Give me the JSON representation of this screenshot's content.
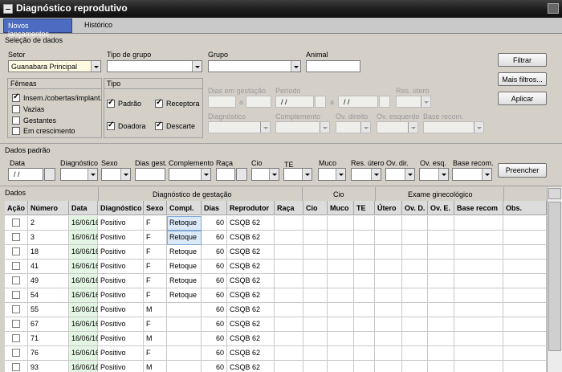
{
  "window": {
    "title": "Diagnóstico reprodutivo"
  },
  "tabs": [
    {
      "label": "Novos lançamentos"
    },
    {
      "label": "Histórico"
    }
  ],
  "selecao": {
    "section_title": "Seleção de dados",
    "setor_label": "Setor",
    "setor_value": "Guanabara Principal",
    "tipo_grupo_label": "Tipo de grupo",
    "grupo_label": "Grupo",
    "animal_label": "Animal",
    "femeas_label": "Fêmeas",
    "femeas_options": [
      {
        "label": "Insem./cobertas/implant.",
        "checked": true
      },
      {
        "label": "Vazias",
        "checked": false
      },
      {
        "label": "Gestantes",
        "checked": false
      },
      {
        "label": "Em crescimento",
        "checked": false
      }
    ],
    "tipo_label": "Tipo",
    "tipo_options": [
      {
        "label": "Padrão",
        "checked": true
      },
      {
        "label": "Receptora",
        "checked": true
      },
      {
        "label": "Doadora",
        "checked": true
      },
      {
        "label": "Descarte",
        "checked": true
      }
    ],
    "dias_gestacao_label": "Dias em gestação",
    "periodo_label": "Período",
    "date_mask": "/ /",
    "a_label": "a",
    "res_utero_label": "Res. útero",
    "diagnostico_label": "Diagnóstico",
    "complemento_label": "Complemento",
    "ov_direito_label": "Ov. direito",
    "ov_esquerdo_label": "Ov. esquerdo",
    "base_recom_label": "Base recom.",
    "btn_filtrar": "Filtrar",
    "btn_mais_filtros": "Mais filtros...",
    "btn_aplicar": "Aplicar"
  },
  "padrao": {
    "section_title": "Dados padrão",
    "labels": {
      "data": "Data",
      "diagnostico": "Diagnóstico",
      "sexo": "Sexo",
      "dias_gest": "Dias gest.",
      "complemento": "Complemento",
      "raca": "Raça",
      "cio": "Cio",
      "te": "TE",
      "muco": "Muco",
      "res_utero": "Res. útero",
      "ov_dir": "Ov. dir.",
      "ov_esq": "Ov. esq.",
      "base_recom": "Base recom."
    },
    "data_value": "/ /",
    "btn_preencher": "Preencher"
  },
  "dados": {
    "section_title": "Dados",
    "group_headers": {
      "diag_gestacao": "Diagnóstico de gestação",
      "cio": "Cio",
      "exame": "Exame ginecológico"
    },
    "columns": [
      "Ação",
      "Número",
      "Data",
      "Diagnóstico",
      "Sexo",
      "Compl.",
      "Dias",
      "Reprodutor",
      "Raça",
      "Cio",
      "Muco",
      "TE",
      "Útero",
      "Ov. D.",
      "Ov. E.",
      "Base recom",
      "Obs."
    ],
    "rows": [
      {
        "numero": "2",
        "data": "16/06/16",
        "diagnostico": "Positivo",
        "sexo": "F",
        "compl": "Retoque",
        "dias": "60",
        "reprodutor": "CSQB 62"
      },
      {
        "numero": "3",
        "data": "16/06/16",
        "diagnostico": "Positivo",
        "sexo": "F",
        "compl": "Retoque",
        "dias": "60",
        "reprodutor": "CSQB 62"
      },
      {
        "numero": "18",
        "data": "16/06/16",
        "diagnostico": "Positivo",
        "sexo": "F",
        "compl": "Retoque",
        "dias": "60",
        "reprodutor": "CSQB 62"
      },
      {
        "numero": "41",
        "data": "16/06/16",
        "diagnostico": "Positivo",
        "sexo": "F",
        "compl": "Retoque",
        "dias": "60",
        "reprodutor": "CSQB 62"
      },
      {
        "numero": "49",
        "data": "16/06/16",
        "diagnostico": "Positivo",
        "sexo": "F",
        "compl": "Retoque",
        "dias": "60",
        "reprodutor": "CSQB 62"
      },
      {
        "numero": "54",
        "data": "16/06/16",
        "diagnostico": "Positivo",
        "sexo": "F",
        "compl": "Retoque",
        "dias": "60",
        "reprodutor": "CSQB 62"
      },
      {
        "numero": "55",
        "data": "16/06/16",
        "diagnostico": "Positivo",
        "sexo": "M",
        "compl": "",
        "dias": "60",
        "reprodutor": "CSQB 62"
      },
      {
        "numero": "67",
        "data": "16/06/16",
        "diagnostico": "Positivo",
        "sexo": "F",
        "compl": "",
        "dias": "60",
        "reprodutor": "CSQB 62"
      },
      {
        "numero": "71",
        "data": "16/06/16",
        "diagnostico": "Positivo",
        "sexo": "M",
        "compl": "",
        "dias": "60",
        "reprodutor": "CSQB 62"
      },
      {
        "numero": "76",
        "data": "16/06/16",
        "diagnostico": "Positivo",
        "sexo": "F",
        "compl": "",
        "dias": "60",
        "reprodutor": "CSQB 62"
      },
      {
        "numero": "93",
        "data": "16/06/16",
        "diagnostico": "Positivo",
        "sexo": "M",
        "compl": "",
        "dias": "60",
        "reprodutor": "CSQB 62"
      }
    ]
  },
  "colors": {
    "tab_active": "#4b6cc1",
    "date_column": "#e3f5e3",
    "selected_cell": "#dceaf8"
  }
}
